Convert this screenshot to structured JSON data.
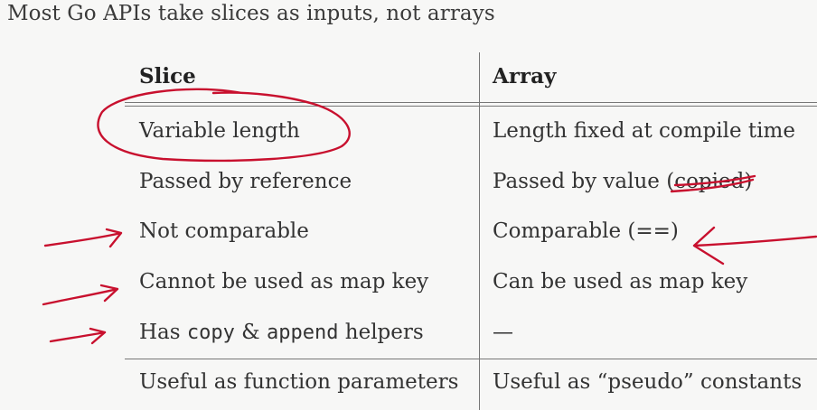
{
  "title": "Most Go APIs take slices as inputs, not arrays",
  "table": {
    "headers": [
      "Slice",
      "Array"
    ],
    "rows": [
      {
        "slice": "Variable length",
        "array": "Length fixed at compile time"
      },
      {
        "slice": "Passed by reference",
        "array_prefix": "Passed by value ",
        "array_struck": "(copied)"
      },
      {
        "slice": "Not comparable",
        "array": "Comparable (==)"
      },
      {
        "slice": "Cannot be used as map key",
        "array": "Can be used as map key"
      },
      {
        "slice_prefix": "Has ",
        "slice_code1": "copy",
        "slice_mid": " & ",
        "slice_code2": "append",
        "slice_suffix": " helpers",
        "array": "—"
      },
      {
        "slice": "Useful as function parameters",
        "array": "Useful as “pseudo” constants"
      }
    ]
  },
  "colors": {
    "ink": "#c8102e",
    "rule": "#777777",
    "text": "#333333"
  }
}
